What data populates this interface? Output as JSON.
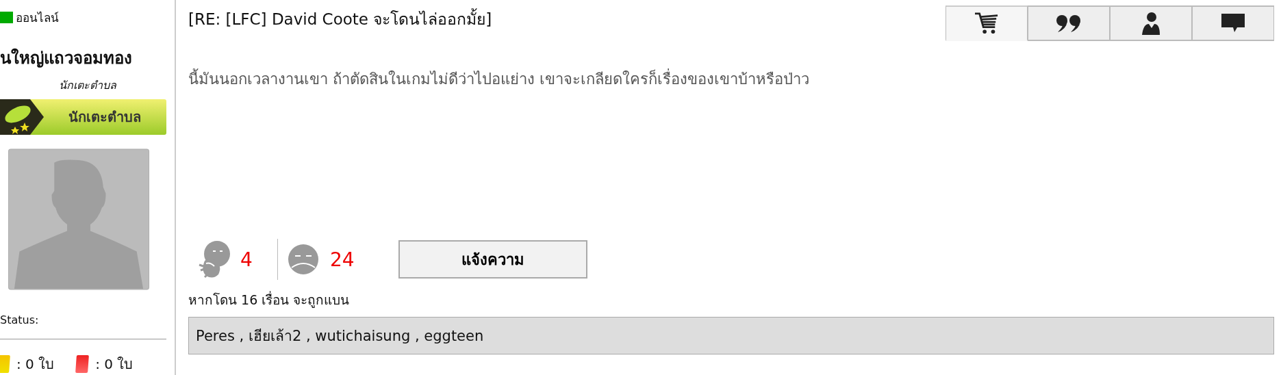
{
  "sidebar": {
    "online_status": "ออนไลน์",
    "online": true,
    "username": "นใหญ่แถวจอมทอง",
    "rank": "นักเตะตำบล",
    "rank_badge": "นักเตะตำบล",
    "status_label": "Status:",
    "cards": [
      {
        "kind": "yellow",
        "count": ": 0 ใบ"
      },
      {
        "kind": "red",
        "count": ": 0 ใบ"
      }
    ]
  },
  "post": {
    "title": "[RE: [LFC] David Coote จะโดนไล่ออกมั้ย]",
    "tabs": [
      {
        "kind": "cart",
        "selected": true
      },
      {
        "kind": "quote",
        "selected": false
      },
      {
        "kind": "user",
        "selected": false
      },
      {
        "kind": "comment",
        "selected": false
      }
    ],
    "body": "นี้มันนอกเวลางานเขา ถ้าตัดสินในเกมไม่ดีว่าไปอแย่าง เขาจะเกลียดใครก็เรื่องของเขาบ้าหรือป่าว",
    "reactions": [
      {
        "kind": "laugh",
        "count": "4"
      },
      {
        "kind": "bored",
        "count": "24"
      }
    ],
    "report_button": "แจ้งความ",
    "ban_notice": "หากโดน 16 เรื่อน จะถูกแบน",
    "reporters": "Peres , เฮียเล้า2 , wutichaisung , eggteen"
  }
}
